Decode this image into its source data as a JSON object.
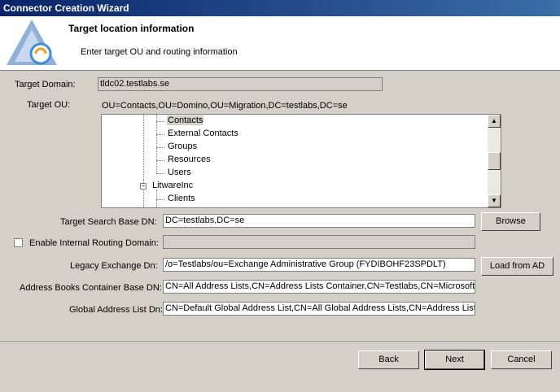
{
  "window": {
    "title": "Connector Creation Wizard"
  },
  "header": {
    "title": "Target location information",
    "subtitle": "Enter target OU and routing information",
    "logo_icon": "wizard-logo-icon"
  },
  "form": {
    "target_domain_label": "Target Domain:",
    "target_domain_value": "tldc02.testlabs.se",
    "target_ou_label": "Target OU:",
    "target_ou_value": "OU=Contacts,OU=Domino,OU=Migration,DC=testlabs,DC=se",
    "search_base_label": "Target Search Base DN:",
    "search_base_value": "DC=testlabs,DC=se",
    "routing_label": "Enable Internal Routing Domain:",
    "routing_value": "",
    "legacy_label": "Legacy Exchange Dn:",
    "legacy_value": "/o=Testlabs/ou=Exchange Administrative Group (FYDIBOHF23SPDLT)",
    "abc_label": "Address Books Container Base DN:",
    "abc_value": "CN=All Address Lists,CN=Address Lists Container,CN=Testlabs,CN=Microsoft Exc",
    "gal_label": "Global Address List Dn:",
    "gal_value": "CN=Default Global Address List,CN=All Global Address Lists,CN=Address Lists Co"
  },
  "tree": {
    "items": [
      "Contacts",
      "External Contacts",
      "Groups",
      "Resources",
      "Users",
      "LitwareInc",
      "Clients"
    ],
    "selected": "Contacts",
    "expander_symbol": "−"
  },
  "buttons": {
    "browse": "Browse",
    "load_from_ad": "Load from AD",
    "back": "Back",
    "next": "Next",
    "cancel": "Cancel"
  }
}
